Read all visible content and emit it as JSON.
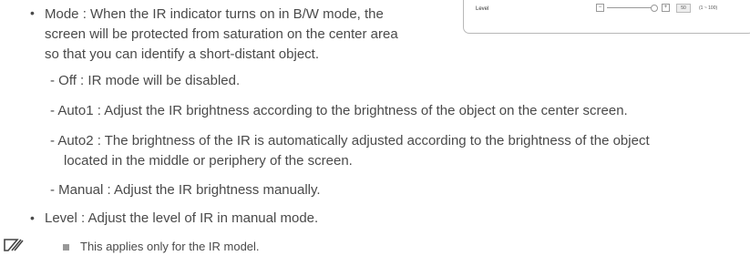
{
  "ui_snippet": {
    "label": "Level",
    "minus": "−",
    "plus": "+",
    "value": "50",
    "range": "(1 ~ 100)"
  },
  "mode": {
    "bullet_line1": "Mode : When the IR indicator turns on in B/W mode, the",
    "bullet_line2": "screen will be protected from saturation on the center area",
    "bullet_line3": "so that you can identify a short-distant object.",
    "off": "- Off : IR mode will be disabled.",
    "auto1": "- Auto1 : Adjust the IR brightness according to the brightness of the object on the center screen.",
    "auto2_line1": "- Auto2 : The brightness of the IR is automatically adjusted according to the brightness of the object",
    "auto2_line2": "located in the middle or periphery of the screen.",
    "manual": "- Manual : Adjust the IR brightness manually."
  },
  "level": {
    "bullet": "Level : Adjust the level of IR in manual mode."
  },
  "note": {
    "text": "This applies only for the IR model."
  }
}
